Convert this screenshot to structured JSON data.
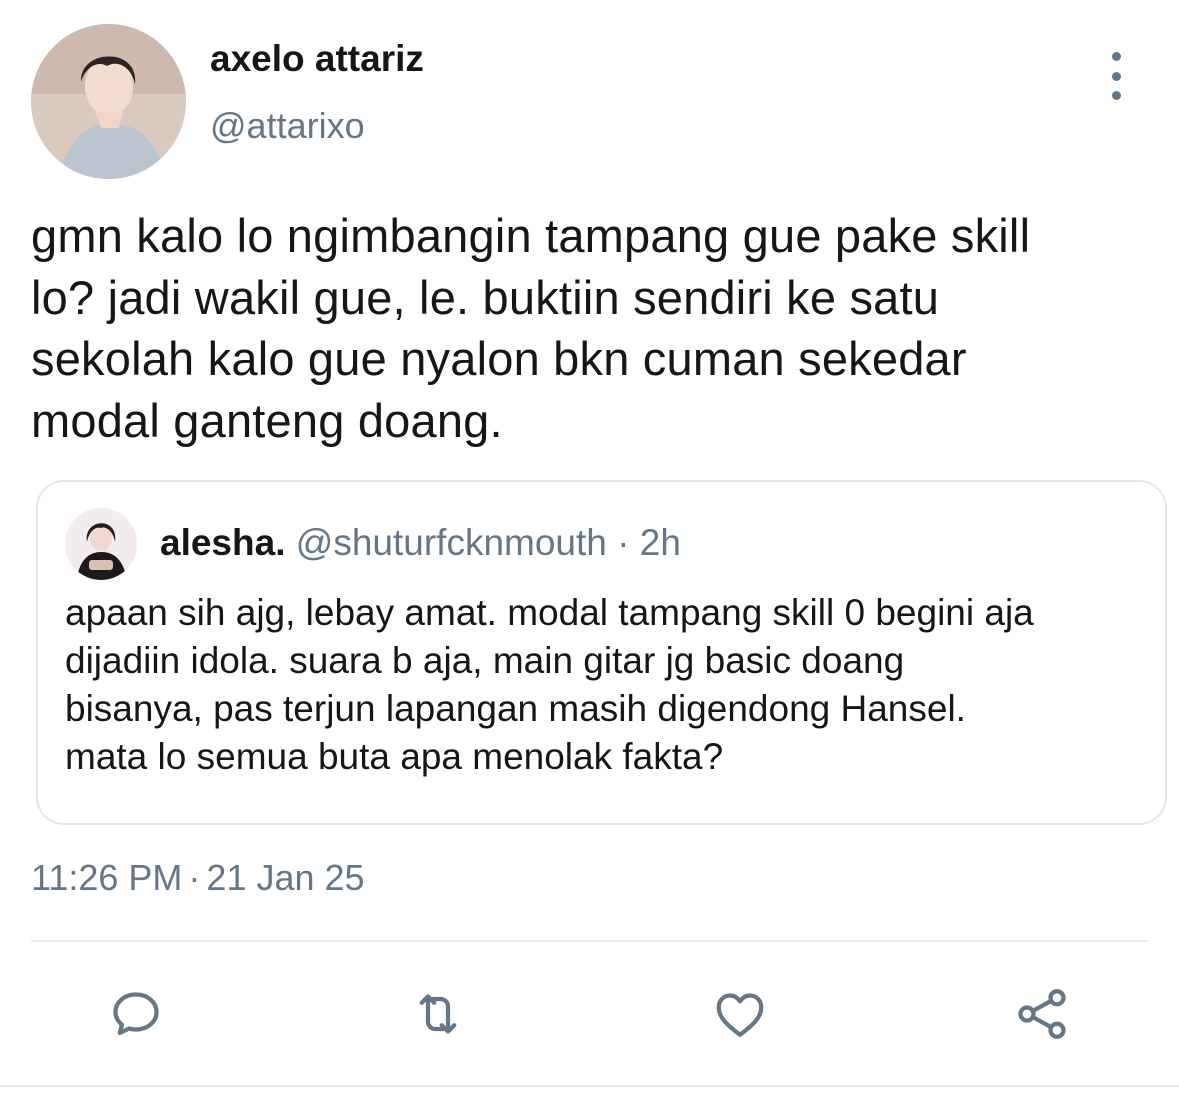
{
  "author": {
    "display_name": "axelo attariz",
    "handle": "@attarixo",
    "avatar_icon": "profile-photo"
  },
  "tweet": {
    "text_lines": [
      "gmn kalo lo ngimbangin tampang gue pake skill",
      "lo? jadi wakil gue, le. buktiin sendiri ke satu",
      "sekolah kalo gue nyalon bkn cuman sekedar",
      "modal ganteng doang."
    ],
    "time": "11:26 PM",
    "date": "21 Jan 25",
    "separator": "·"
  },
  "quoted_tweet": {
    "display_name": "alesha.",
    "handle": "@shuturfcknmouth",
    "separator": "·",
    "time_ago": "2h",
    "text_lines": [
      "apaan sih ajg, lebay amat. modal tampang skill 0 begini aja",
      "dijadiin idola. suara b aja, main gitar jg basic doang",
      "bisanya, pas terjun lapangan masih digendong Hansel.",
      "mata lo semua buta apa menolak fakta?"
    ]
  },
  "actions": [
    {
      "icon": "reply-icon"
    },
    {
      "icon": "retweet-icon"
    },
    {
      "icon": "like-icon"
    },
    {
      "icon": "share-icon"
    }
  ],
  "colors": {
    "primary_text": "#14171a",
    "secondary_text": "#657786",
    "border": "#e1e8ed"
  }
}
